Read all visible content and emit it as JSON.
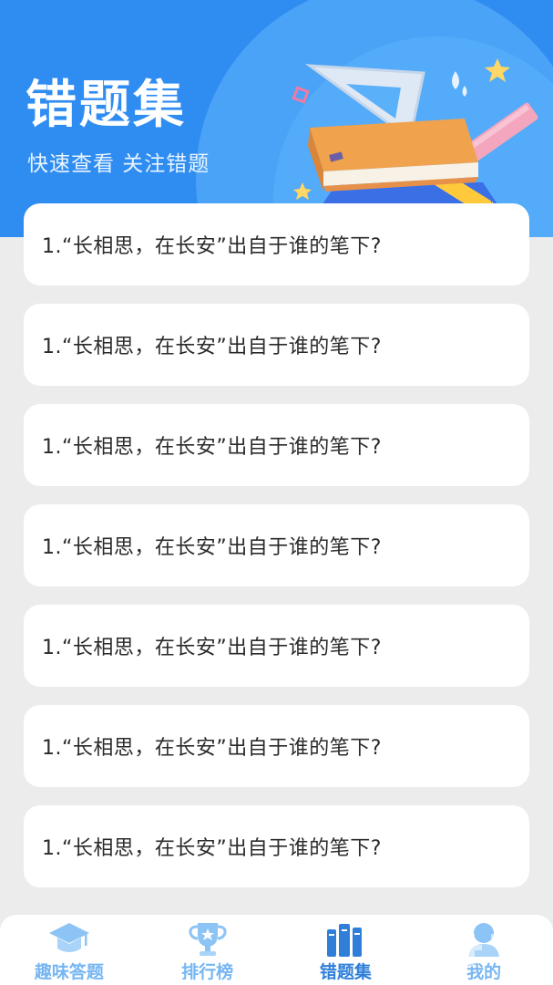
{
  "header": {
    "title": "错题集",
    "subtitle": "快速查看 关注错题"
  },
  "questions": [
    {
      "text": "1.“长相思，在长安”出自于谁的笔下?"
    },
    {
      "text": "1.“长相思，在长安”出自于谁的笔下?"
    },
    {
      "text": "1.“长相思，在长安”出自于谁的笔下?"
    },
    {
      "text": "1.“长相思，在长安”出自于谁的笔下?"
    },
    {
      "text": "1.“长相思，在长安”出自于谁的笔下?"
    },
    {
      "text": "1.“长相思，在长安”出自于谁的笔下?"
    },
    {
      "text": "1.“长相思，在长安”出自于谁的笔下?"
    }
  ],
  "nav": {
    "items": [
      {
        "label": "趣味答题",
        "icon": "graduation-cap-icon",
        "active": false
      },
      {
        "label": "排行榜",
        "icon": "trophy-icon",
        "active": false
      },
      {
        "label": "错题集",
        "icon": "books-icon",
        "active": true
      },
      {
        "label": "我的",
        "icon": "user-icon",
        "active": false
      }
    ]
  },
  "colors": {
    "primary": "#2f8df2",
    "nav_active": "#2f7fd9",
    "nav_inactive": "#76b6f2",
    "background": "#ececec"
  }
}
